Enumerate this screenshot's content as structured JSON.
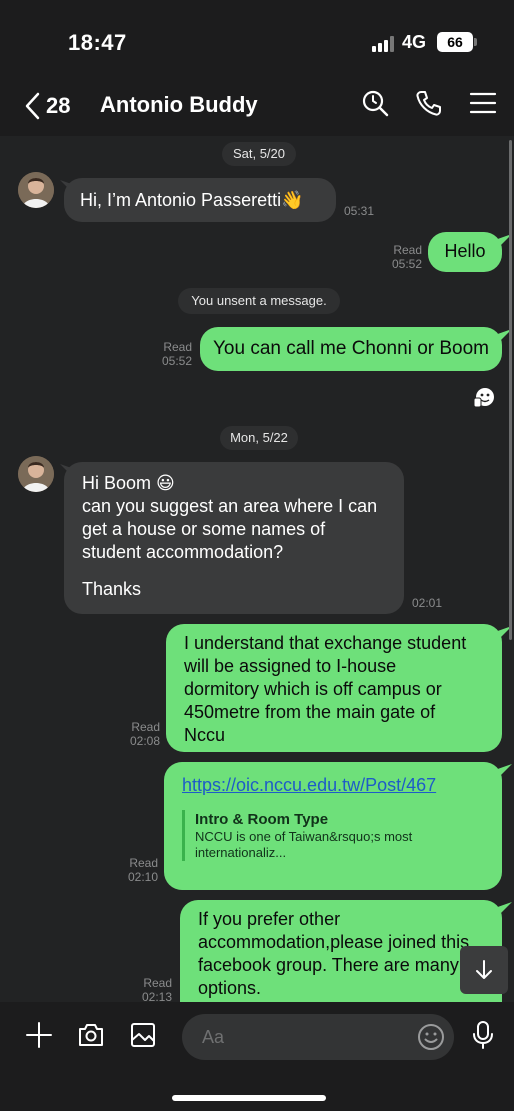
{
  "status_bar": {
    "time": "18:47",
    "network": "4G",
    "battery": "66"
  },
  "header": {
    "back_count": "28",
    "title": "Antonio Buddy",
    "icons": [
      "search-icon",
      "phone-icon",
      "menu-icon"
    ]
  },
  "dates": {
    "first": "Sat, 5/20",
    "second": "Mon, 5/22"
  },
  "messages": {
    "m1": {
      "text": "Hi, I’m Antonio Passeretti👋",
      "time": "05:31"
    },
    "m2": {
      "text": "Hello",
      "read": "Read",
      "time": "05:52"
    },
    "system": "You unsent a message.",
    "m3": {
      "text": "You can call me Chonni or Boom",
      "read": "Read",
      "time": "05:52"
    },
    "m4": {
      "line1": "Hi Boom 😃",
      "line2": "can you suggest an area where I can",
      "line3": "get a house or some names of",
      "line4": "student accommodation?",
      "line5": "Thanks",
      "time": "02:01"
    },
    "m5": {
      "line1": "I understand that exchange student",
      "line2": "will be assigned to I-house",
      "line3": "dormitory which is off campus or",
      "line4": "450metre from the main gate of",
      "line5": "Nccu",
      "read": "Read",
      "time": "02:08"
    },
    "m6": {
      "link": "https://oic.nccu.edu.tw/Post/467",
      "preview_title": "Intro & Room Type",
      "preview_line1": "NCCU is one of Taiwan&rsquo;s most",
      "preview_line2": "internationaliz...",
      "read": "Read",
      "time": "02:10"
    },
    "m7": {
      "line1": "If you prefer other",
      "line2": "accommodation,please joined this",
      "line3": "facebook group. There are many",
      "line4": "options.",
      "read": "Read",
      "time": "02:13"
    }
  },
  "input": {
    "placeholder": "Aa"
  },
  "colors": {
    "outgoing_bubble": "#6ee07a",
    "incoming_bubble": "#3a3b3c",
    "background": "#222324"
  }
}
